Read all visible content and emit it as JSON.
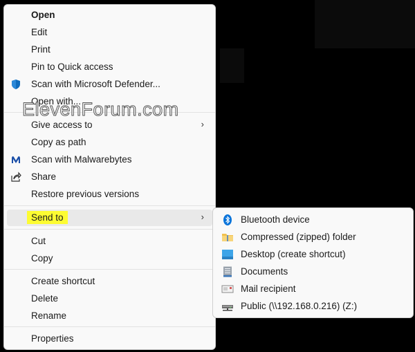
{
  "watermark": "ElevenForum.com",
  "context_menu": {
    "items": [
      {
        "label": "Open",
        "bold": true
      },
      {
        "label": "Edit"
      },
      {
        "label": "Print"
      },
      {
        "label": "Pin to Quick access"
      },
      {
        "label": "Scan with Microsoft Defender...",
        "icon": "defender-shield-icon"
      },
      {
        "label": "Open with..."
      },
      {
        "label": "Give access to",
        "submenu": true
      },
      {
        "label": "Copy as path"
      },
      {
        "label": "Scan with Malwarebytes",
        "icon": "malwarebytes-icon"
      },
      {
        "label": "Share",
        "icon": "share-icon"
      },
      {
        "label": "Restore previous versions"
      },
      {
        "label": "Send to",
        "submenu": true,
        "highlighted": true
      },
      {
        "label": "Cut"
      },
      {
        "label": "Copy"
      },
      {
        "label": "Create shortcut"
      },
      {
        "label": "Delete"
      },
      {
        "label": "Rename"
      },
      {
        "label": "Properties"
      }
    ]
  },
  "send_to_menu": {
    "items": [
      {
        "label": "Bluetooth device",
        "icon": "bluetooth-icon"
      },
      {
        "label": "Compressed (zipped) folder",
        "icon": "zip-folder-icon"
      },
      {
        "label": "Desktop (create shortcut)",
        "icon": "desktop-icon"
      },
      {
        "label": "Documents",
        "icon": "documents-icon"
      },
      {
        "label": "Mail recipient",
        "icon": "mail-icon"
      },
      {
        "label": "Public (\\\\192.168.0.216) (Z:)",
        "icon": "network-drive-icon"
      }
    ]
  },
  "colors": {
    "highlight": "#fdfc32",
    "hover": "#e9e9e9",
    "defender_blue": "#0f6cbd"
  }
}
